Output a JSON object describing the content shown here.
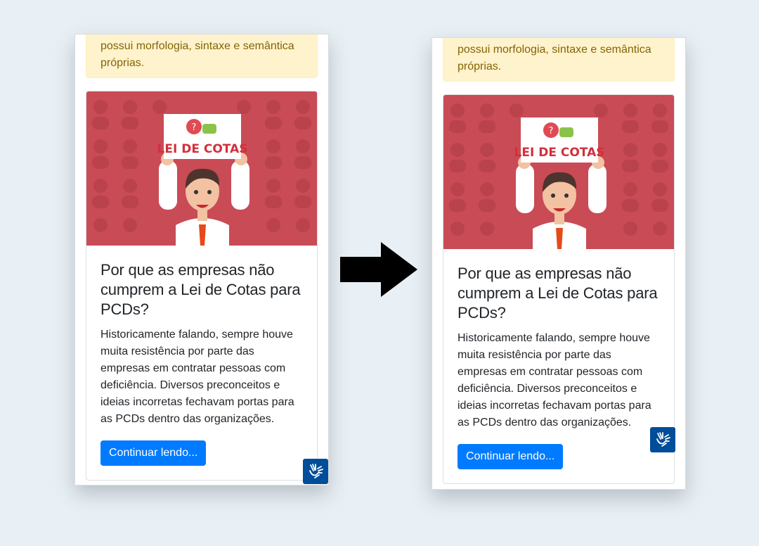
{
  "before": {
    "alert_text": "possui morfologia, sintaxe e semântica próprias.",
    "card": {
      "sign_text": "LEI DE COTAS",
      "title": "Por que as empresas não cumprem a Lei de Cotas para PCDs?",
      "text": "Historicamente falando, sempre houve muita resistência por parte das empresas em contratar pessoas com deficiência. Diversos preconceitos e ideias incorretas fechavam portas para as PCDs dentro das organizações.",
      "button_label": "Continuar lendo..."
    },
    "widget_icon": "sign-language-hands-icon"
  },
  "after": {
    "alert_text": "possui morfologia, sintaxe e semântica próprias.",
    "card": {
      "sign_text": "LEI DE COTAS",
      "title": "Por que as empresas não cumprem a Lei de Cotas para PCDs?",
      "text": "Historicamente falando, sempre houve muita resistência por parte das empresas em contratar pessoas com deficiência. Diversos preconceitos e ideias incorretas fechavam portas para as PCDs dentro das organizações.",
      "button_label": "Continuar lendo..."
    },
    "widget_icon": "sign-language-hands-icon"
  },
  "transition_icon": "right-arrow-icon",
  "colors": {
    "background": "#e8f0f5",
    "alert_bg": "#fff3cd",
    "alert_text": "#856404",
    "image_red": "#c94b55",
    "button": "#007bff",
    "widget": "#004d9a"
  }
}
